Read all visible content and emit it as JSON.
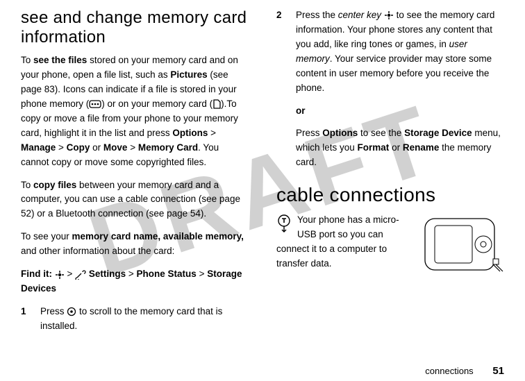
{
  "watermark": "DRAFT",
  "left": {
    "heading": "see and change memory card information",
    "para1_pre": "To ",
    "para1_bold1": "see the files",
    "para1_mid1": " stored on your memory card and on your phone, open a file list, such as ",
    "para1_cond1": "Pictures",
    "para1_mid2": " (see page 83). Icons can indicate if a file is stored in your phone memory (",
    "para1_mid3": ") or on your memory card (",
    "para1_mid4": ").To copy or move a file from your phone to your memory card, highlight it in the list and press ",
    "para1_cond2": "Options",
    "para1_gt1": " > ",
    "para1_cond3": "Manage",
    "para1_gt2": " > ",
    "para1_cond4": "Copy",
    "para1_or": " or ",
    "para1_cond5": "Move",
    "para1_gt3": " > ",
    "para1_cond6": "Memory Card",
    "para1_end": ". You cannot copy or move some copyrighted files.",
    "para2_pre": "To ",
    "para2_bold": "copy files",
    "para2_rest": " between your memory card and a computer, you can use a cable connection (see page 52) or a Bluetooth connection (see page 54).",
    "para3_pre": "To see your ",
    "para3_bold": "memory card name, available memory,",
    "para3_rest": " and other information about the card:",
    "findit_label": "Find it: ",
    "findit_gt1": " > ",
    "findit_cond1": "Settings",
    "findit_gt2": " > ",
    "findit_cond2": "Phone Status",
    "findit_gt3": " > ",
    "findit_cond3": "Storage Devices",
    "step1_num": "1",
    "step1_pre": "Press ",
    "step1_rest": " to scroll to the memory card that is installed."
  },
  "right": {
    "step2_num": "2",
    "step2_pre": "Press the ",
    "step2_ital": "center key ",
    "step2_mid": " to see the memory card information. Your phone stores any content that you add, like ring tones or games, in ",
    "step2_ital2": "user memory",
    "step2_rest": ". Your service provider may store some content in user memory before you receive the phone.",
    "or": "or",
    "orpara_pre": "Press ",
    "orpara_cond1": "Options",
    "orpara_mid1": " to see the ",
    "orpara_cond2": "Storage Device",
    "orpara_mid2": " menu, which lets you ",
    "orpara_cond3": "Format",
    "orpara_or": " or ",
    "orpara_cond4": "Rename",
    "orpara_end": " the memory card.",
    "heading2": "cable connections",
    "cable_para": "Your phone has a micro-USB port so you can connect it to a computer to transfer data."
  },
  "footer": {
    "section": "connections",
    "page": "51"
  }
}
